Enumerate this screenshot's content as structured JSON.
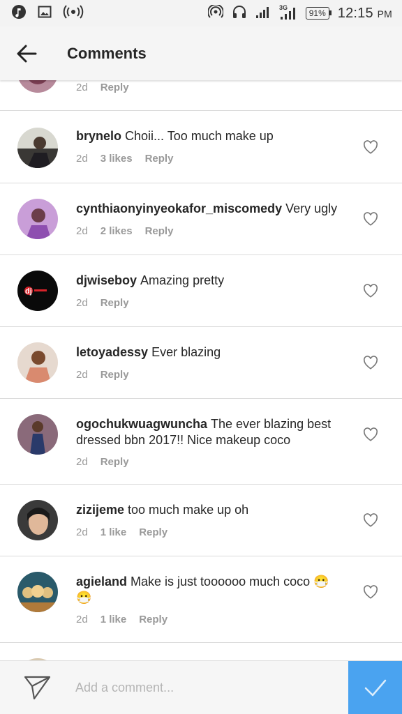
{
  "status_bar": {
    "battery": "91%",
    "time": "12:15",
    "ampm": "PM",
    "icons": [
      "music-icon",
      "image-icon",
      "radio-icon",
      "hotspot-icon",
      "headphones-icon",
      "signal-icon",
      "network-3g-icon",
      "battery-icon"
    ]
  },
  "header": {
    "title": "Comments"
  },
  "partial_comment": {
    "time": "2d",
    "reply": "Reply"
  },
  "comments": [
    {
      "username": "brynelo",
      "text": "Choii... Too much make up",
      "time": "2d",
      "likes": "3 likes",
      "reply": "Reply"
    },
    {
      "username": "cynthiaonyinyeokafor_miscomedy",
      "text": "Very ugly",
      "time": "2d",
      "likes": "2 likes",
      "reply": "Reply"
    },
    {
      "username": "djwiseboy",
      "text": "Amazing pretty",
      "time": "2d",
      "likes": "",
      "reply": "Reply"
    },
    {
      "username": "letoyadessy",
      "text": "Ever blazing",
      "time": "2d",
      "likes": "",
      "reply": "Reply"
    },
    {
      "username": "ogochukwuagwuncha",
      "text": "The ever blazing best dressed bbn 2017!! Nice makeup coco",
      "time": "2d",
      "likes": "",
      "reply": "Reply"
    },
    {
      "username": "zizijeme",
      "text": "too much make up oh",
      "time": "2d",
      "likes": "1 like",
      "reply": "Reply"
    },
    {
      "username": "agieland",
      "text": "Make is just toooooo much coco 😷 😷 ",
      "time": "2d",
      "likes": "1 like",
      "reply": "Reply"
    }
  ],
  "composer": {
    "placeholder": "Add a comment..."
  },
  "colors": {
    "accent": "#4aa3f0",
    "meta": "#999999",
    "divider": "#dbdbdb"
  }
}
